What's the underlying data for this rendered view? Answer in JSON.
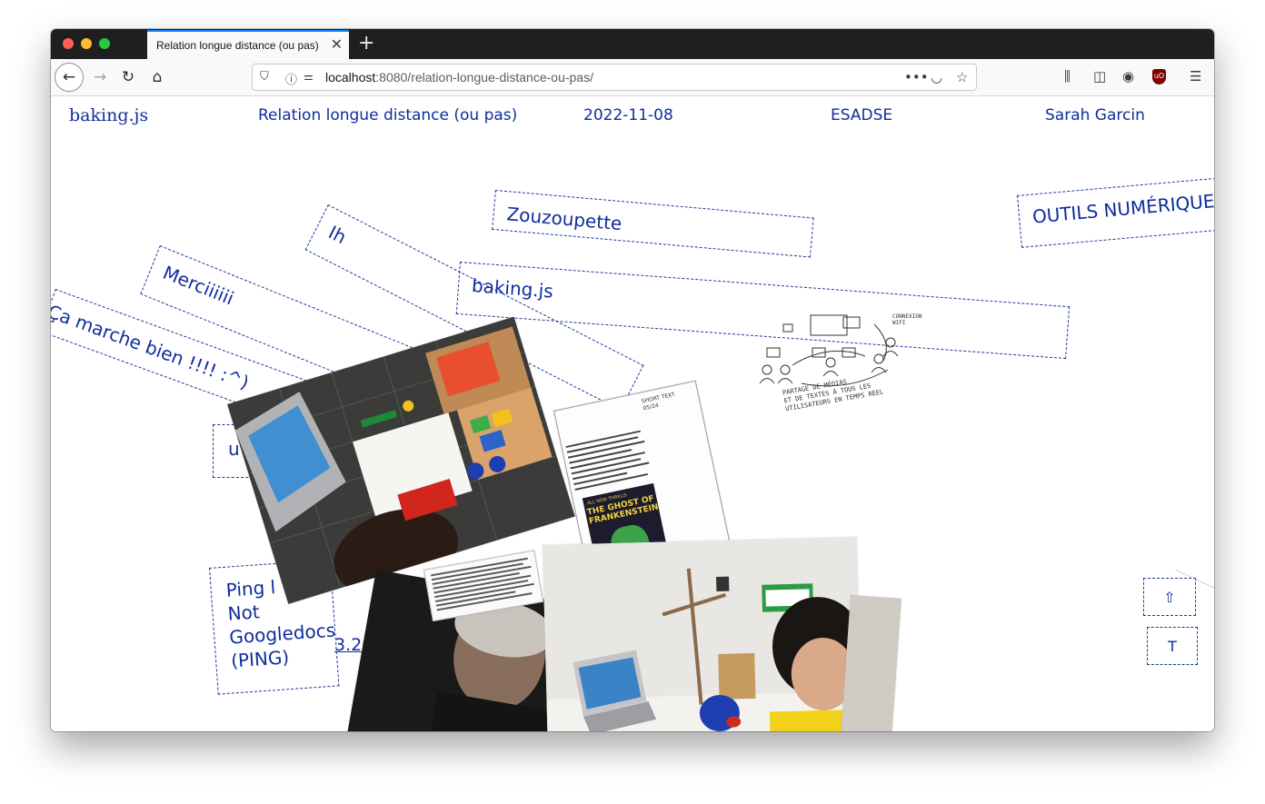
{
  "browser": {
    "tab_title": "Relation longue distance (ou pas)",
    "tab_close": "✕",
    "new_tab": "+",
    "url_host": "localhost",
    "url_rest": ":8080/relation-longue-distance-ou-pas/",
    "icons": [
      "back-arrow-icon",
      "forward-arrow-icon",
      "reload-icon",
      "home-icon",
      "shield-icon",
      "info-icon",
      "permissions-icon",
      "more-icon",
      "pocket-icon",
      "star-icon",
      "library-icon",
      "sidebar-icon",
      "account-icon",
      "ublock-icon",
      "menu-icon"
    ]
  },
  "header": {
    "logo": "baking.js",
    "title": "Relation longue distance (ou pas)",
    "date": "2022-11-08",
    "school": "ESADSE",
    "author": "Sarah Garcin"
  },
  "labels": {
    "zouzoupette": "Zouzoupette",
    "outils": "OUTILS NUMÉRIQUE",
    "ih": "Ih",
    "bakingjs": "baking.js",
    "merci": "Merciiiiii",
    "camarche": "Ça marche bien !!!! :^)",
    "u": "u",
    "ping_1": "Ping l",
    "ping_2": "Not",
    "ping_3": "Googledocs",
    "ping_4": "(PING)",
    "ip_fragment": "3.20.8"
  },
  "sketch_text": {
    "line1": "PARTAGE DE MÉDIAS",
    "line2": "ET DE TEXTES À TOUS LES",
    "line3": "UTILISATEURS EN TEMPS RÉEL",
    "side": "CONNEXION WIFI"
  },
  "poster": {
    "header": "SHORT TEXT",
    "subheader": "05/24",
    "comic_line1": "ALL NEW THRILLS",
    "comic_line2": "THE GHOST OF",
    "comic_line3": "FRANKENSTEIN"
  },
  "side_buttons": {
    "up": "⇧",
    "text": "T"
  }
}
